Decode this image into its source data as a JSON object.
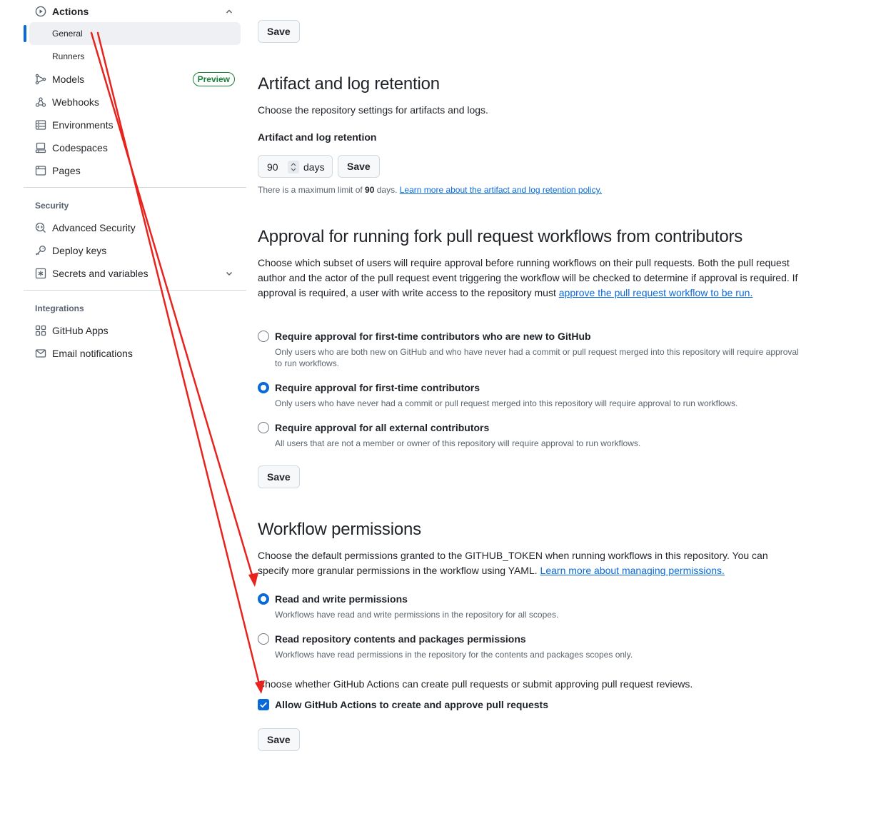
{
  "sidebar": {
    "actions": {
      "label": "Actions",
      "icon": "play-circle-icon"
    },
    "actions_sub": [
      {
        "label": "General",
        "selected": true
      },
      {
        "label": "Runners",
        "selected": false
      }
    ],
    "items_top": [
      {
        "label": "Models",
        "icon": "models-icon",
        "badge": "Preview"
      },
      {
        "label": "Webhooks",
        "icon": "webhook-icon"
      },
      {
        "label": "Environments",
        "icon": "server-icon"
      },
      {
        "label": "Codespaces",
        "icon": "codespaces-icon"
      },
      {
        "label": "Pages",
        "icon": "browser-icon"
      }
    ],
    "security": {
      "heading": "Security",
      "items": [
        {
          "label": "Advanced Security",
          "icon": "codescan-icon"
        },
        {
          "label": "Deploy keys",
          "icon": "key-icon"
        },
        {
          "label": "Secrets and variables",
          "icon": "asterisk-icon"
        }
      ]
    },
    "integrations": {
      "heading": "Integrations",
      "items": [
        {
          "label": "GitHub Apps",
          "icon": "apps-icon"
        },
        {
          "label": "Email notifications",
          "icon": "mail-icon"
        }
      ]
    }
  },
  "main": {
    "top_save_label": "Save",
    "retention": {
      "title": "Artifact and log retention",
      "description": "Choose the repository settings for artifacts and logs.",
      "field_label": "Artifact and log retention",
      "value": "90",
      "unit": "days",
      "save_label": "Save",
      "note_prefix": "There is a maximum limit of ",
      "note_bold": "90",
      "note_mid": " days. ",
      "note_link": "Learn more about the artifact and log retention policy."
    },
    "fork_approval": {
      "title": "Approval for running fork pull request workflows from contributors",
      "description": "Choose which subset of users will require approval before running workflows on their pull requests. Both the pull request author and the actor of the pull request event triggering the workflow will be checked to determine if approval is required. If approval is required, a user with write access to the repository must ",
      "description_link": "approve the pull request workflow to be run.",
      "options": [
        {
          "title": "Require approval for first-time contributors who are new to GitHub",
          "desc": "Only users who are both new on GitHub and who have never had a commit or pull request merged into this repository will require approval to run workflows.",
          "selected": false
        },
        {
          "title": "Require approval for first-time contributors",
          "desc": "Only users who have never had a commit or pull request merged into this repository will require approval to run workflows.",
          "selected": true
        },
        {
          "title": "Require approval for all external contributors",
          "desc": "All users that are not a member or owner of this repository will require approval to run workflows.",
          "selected": false
        }
      ],
      "save_label": "Save"
    },
    "workflow_permissions": {
      "title": "Workflow permissions",
      "description": "Choose the default permissions granted to the GITHUB_TOKEN when running workflows in this repository. You can specify more granular permissions in the workflow using YAML. ",
      "description_link": "Learn more about managing permissions.",
      "options": [
        {
          "title": "Read and write permissions",
          "desc": "Workflows have read and write permissions in the repository for all scopes.",
          "selected": true
        },
        {
          "title": "Read repository contents and packages permissions",
          "desc": "Workflows have read permissions in the repository for the contents and packages scopes only.",
          "selected": false
        }
      ],
      "pr_question": "Choose whether GitHub Actions can create pull requests or submit approving pull request reviews.",
      "checkbox_label": "Allow GitHub Actions to create and approve pull requests",
      "checkbox_checked": true,
      "save_label": "Save"
    }
  },
  "colors": {
    "accent": "#0969da",
    "success": "#1a7f37",
    "annotation_arrow": "#e8231d"
  }
}
